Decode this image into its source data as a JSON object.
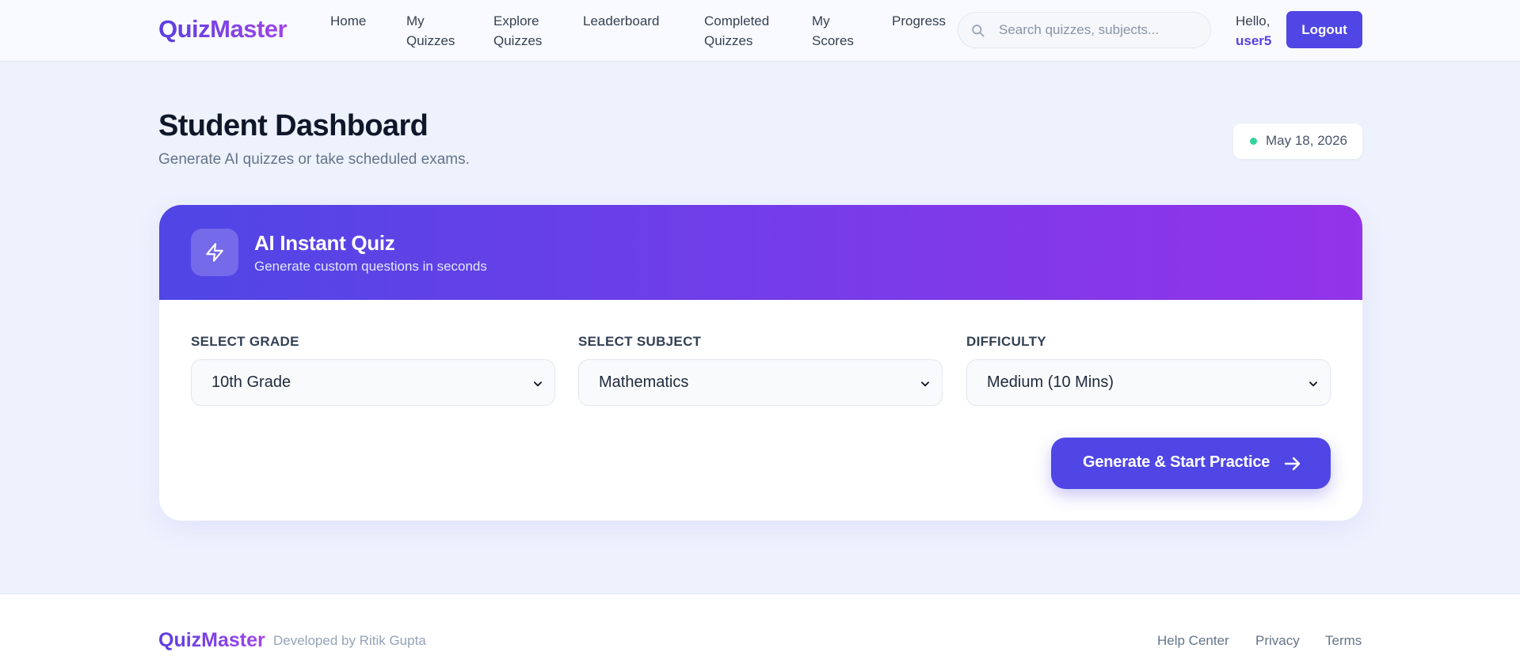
{
  "app": {
    "name": "QuizMaster"
  },
  "nav": {
    "links": [
      {
        "label_line1": "Home",
        "label_line2": ""
      },
      {
        "label_line1": "My",
        "label_line2": "Quizzes"
      },
      {
        "label_line1": "Explore",
        "label_line2": "Quizzes"
      },
      {
        "label_line1": "Leaderboard",
        "label_line2": ""
      },
      {
        "label_line1": "Completed",
        "label_line2": "Quizzes"
      },
      {
        "label_line1": "My",
        "label_line2": "Scores"
      },
      {
        "label_line1": "Progress",
        "label_line2": ""
      }
    ],
    "search_placeholder": "Search quizzes, subjects...",
    "greeting": "Hello,",
    "username": "user5",
    "logout_label": "Logout"
  },
  "header": {
    "title": "Student Dashboard",
    "subtitle": "Generate AI quizzes or take scheduled exams.",
    "date": "May 18, 2026",
    "status_color": "#34d399"
  },
  "quiz_card": {
    "icon": "lightning-bolt-icon",
    "title": "AI Instant Quiz",
    "subtitle": "Generate custom questions in seconds",
    "fields": [
      {
        "label": "SELECT GRADE",
        "value": "10th Grade"
      },
      {
        "label": "SELECT SUBJECT",
        "value": "Mathematics"
      },
      {
        "label": "DIFFICULTY",
        "value": "Medium (10 Mins)"
      }
    ],
    "generate_label": "Generate & Start Practice"
  },
  "footer": {
    "logo": "QuizMaster",
    "credit": "Developed by Ritik Gupta",
    "links": [
      "Help Center",
      "Privacy",
      "Terms"
    ]
  },
  "colors": {
    "accent": "#4f46e5",
    "gradient_end": "#9333ea",
    "background": "#eef2fd"
  }
}
